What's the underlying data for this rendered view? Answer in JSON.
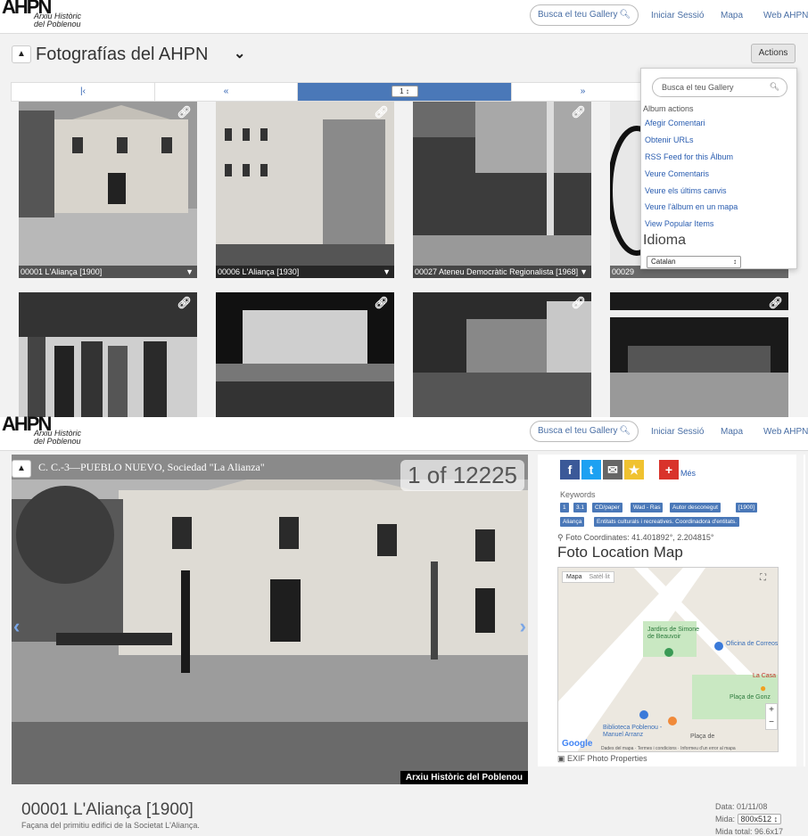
{
  "colors": {
    "accent": "#4a78b8",
    "link": "#2a5db0",
    "bg": "#f2f2f2"
  },
  "header": {
    "logo_big": "AHPN",
    "logo_small_1": "Arxiu Històric",
    "logo_small_2": "del Poblenou",
    "search": "Busca el teu Gallery",
    "login": "Iniciar Sessió",
    "map": "Mapa",
    "web": "Web AHPN"
  },
  "album": {
    "title": "Fotografías del AHPN",
    "actions": "Actions",
    "pager_page": "1"
  },
  "thumbnails": [
    {
      "caption": "00001 L'Aliança [1900]"
    },
    {
      "caption": "00006 L'Aliança [1930]"
    },
    {
      "caption": "00027 Ateneu Democràtic Regionalista [1968]"
    },
    {
      "caption": "00029"
    },
    {
      "caption": ""
    },
    {
      "caption": ""
    },
    {
      "caption": ""
    },
    {
      "caption": ""
    }
  ],
  "dropdown": {
    "search": "Busca el teu Gallery",
    "heading": "Album actions",
    "items": [
      "Afegir Comentari",
      "Obtenir URLs",
      "RSS Feed for this Àlbum",
      "Veure Comentaris",
      "Veure els últims canvis",
      "Veure l'àlbum en un mapa",
      "View Popular Items"
    ],
    "language_label": "Idioma",
    "language_value": "Catalan"
  },
  "viewer": {
    "counter": "1 of 12225",
    "watermark": "Arxiu Històric del Poblenou",
    "photo_text": "C. C.-3—PUEBLO NUEVO, Sociedad \"La Alianza\""
  },
  "side": {
    "more": "Més",
    "keywords_label": "Keywords",
    "tags": [
      "1",
      "3.1",
      "CD/paper",
      "Wad - Ras",
      "Autor desconegut",
      "[1900]",
      "Aliança",
      "Entitats culturals i recreatives. Coordinadora d'entitats."
    ],
    "coords": "Foto Coordinates: 41.401892°, 2.204815°",
    "map_title": "Foto Location Map",
    "map_tab_1": "Mapa",
    "map_tab_2": "Satèl·lit",
    "map_labels": [
      "Jardins de Simone de Beauvoir",
      "Oficina de Correos",
      "La Casa",
      "Plaça de Gonz",
      "Biblioteca Poblenou - Manuel Arranz",
      "Plaça de",
      "Google"
    ],
    "map_footer": "Dades del mapa · Termes i condicions · Informeu d'un error al mapa",
    "exif": "EXIF Photo Properties"
  },
  "photo_info": {
    "title": "00001 L'Aliança [1900]",
    "subtitle": "Façana del primitiu edifici de la Societat L'Aliança.",
    "date": "Data: 01/11/08",
    "size_label": "Mida:",
    "size_value": "800x512",
    "total": "Mida total: 96.6x17"
  }
}
